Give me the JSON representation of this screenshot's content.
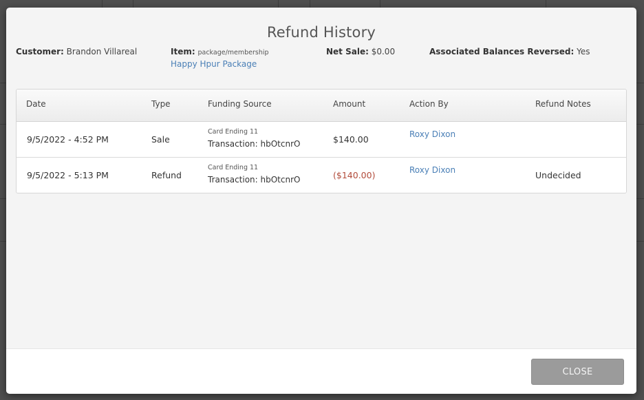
{
  "modal": {
    "title": "Refund History",
    "customer_label": "Customer:",
    "customer_value": "Brandon Villareal",
    "item_label": "Item:",
    "item_type": "package/membership",
    "item_name": "Happy Hpur Package",
    "net_sale_label": "Net Sale:",
    "net_sale_value": "$0.00",
    "balances_label": "Associated Balances Reversed:",
    "balances_value": "Yes"
  },
  "table": {
    "headers": [
      "Date",
      "Type",
      "Funding Source",
      "Amount",
      "Action By",
      "Refund Notes"
    ],
    "rows": [
      {
        "date": "9/5/2022 - 4:52 PM",
        "type": "Sale",
        "funding_card": "Card Ending 11",
        "funding_txn": "Transaction: hbOtcnrO",
        "amount": "$140.00",
        "action_by": "Roxy Dixon",
        "notes": ""
      },
      {
        "date": "9/5/2022 - 5:13 PM",
        "type": "Refund",
        "funding_card": "Card Ending 11",
        "funding_txn": "Transaction: hbOtcnrO",
        "amount": "($140.00)",
        "action_by": "Roxy Dixon",
        "notes": "Undecided"
      }
    ]
  },
  "footer": {
    "close_label": "CLOSE"
  },
  "colors": {
    "link": "#4a7fb6",
    "negative_amount": "#b24b3a",
    "close_button": "#9b9b9b"
  }
}
